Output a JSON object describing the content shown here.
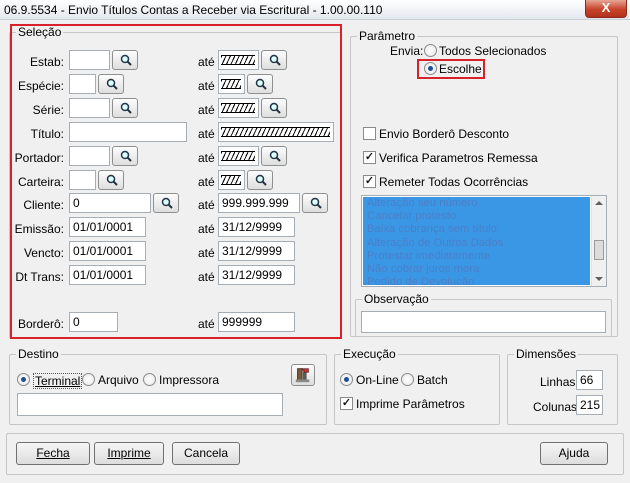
{
  "window": {
    "title": "06.9.5534 - Envio Títulos Contas a Receber via Escritural - 1.00.00.110",
    "close_glyph": "X"
  },
  "selecao": {
    "legend": "Seleção",
    "ate": "até",
    "rows": {
      "estab": {
        "label": "Estab:",
        "from": "",
        "to_hatched": true
      },
      "especie": {
        "label": "Espécie:",
        "from": "",
        "to_hatched": true
      },
      "serie": {
        "label": "Série:",
        "from": "",
        "to_hatched": true
      },
      "titulo": {
        "label": "Título:",
        "from": "",
        "to_hatched": true
      },
      "portador": {
        "label": "Portador:",
        "from": "",
        "to_hatched": true
      },
      "carteira": {
        "label": "Carteira:",
        "from": "",
        "to_hatched": true
      },
      "cliente": {
        "label": "Cliente:",
        "from": "0",
        "to": "999.999.999"
      },
      "emissao": {
        "label": "Emissão:",
        "from": "01/01/0001",
        "to": "31/12/9999"
      },
      "vencto": {
        "label": "Vencto:",
        "from": "01/01/0001",
        "to": "31/12/9999"
      },
      "dt_trans": {
        "label": "Dt Trans:",
        "from": "01/01/0001",
        "to": "31/12/9999"
      },
      "bordero": {
        "label": "Borderô:",
        "from": "0",
        "to": "999999"
      }
    }
  },
  "parametro": {
    "legend": "Parâmetro",
    "envia_label": "Envia:",
    "envia_options": [
      "Todos Selecionados",
      "Escolhe"
    ],
    "envia_selected": "Escolhe",
    "checks": [
      {
        "label": "Envio Borderô Desconto",
        "checked": false
      },
      {
        "label": "Verifica Parametros Remessa",
        "checked": true
      },
      {
        "label": "Remeter Todas Ocorrências",
        "checked": true
      }
    ],
    "ocorrencias": [
      "Alteração seu número",
      "Cancelar protesto",
      "Baixa cobrança sem título",
      "Alteração de Outros Dados",
      "Protestar imediatamente",
      "Não cobrar juros mora",
      "Pedido de Devolução"
    ]
  },
  "observacao": {
    "legend": "Observação",
    "value": ""
  },
  "destino": {
    "legend": "Destino",
    "options": [
      "Terminal",
      "Arquivo",
      "Impressora"
    ],
    "selected": "Terminal",
    "value": "",
    "tool_icon": "config-tool-icon"
  },
  "execucao": {
    "legend": "Execução",
    "options": [
      "On-Line",
      "Batch"
    ],
    "selected": "On-Line",
    "imprime_label": "Imprime Parâmetros",
    "imprime_checked": true
  },
  "dimensoes": {
    "legend": "Dimensões",
    "linhas_label": "Linhas:",
    "linhas": "66",
    "colunas_label": "Colunas:",
    "colunas": "215"
  },
  "buttons": {
    "fecha": "Fecha",
    "imprime": "Imprime",
    "cancela": "Cancela",
    "ajuda": "Ajuda"
  },
  "colors": {
    "highlight": "#d7212b",
    "list_bg": "#3a97e6",
    "list_text": "#4b7fc7"
  }
}
